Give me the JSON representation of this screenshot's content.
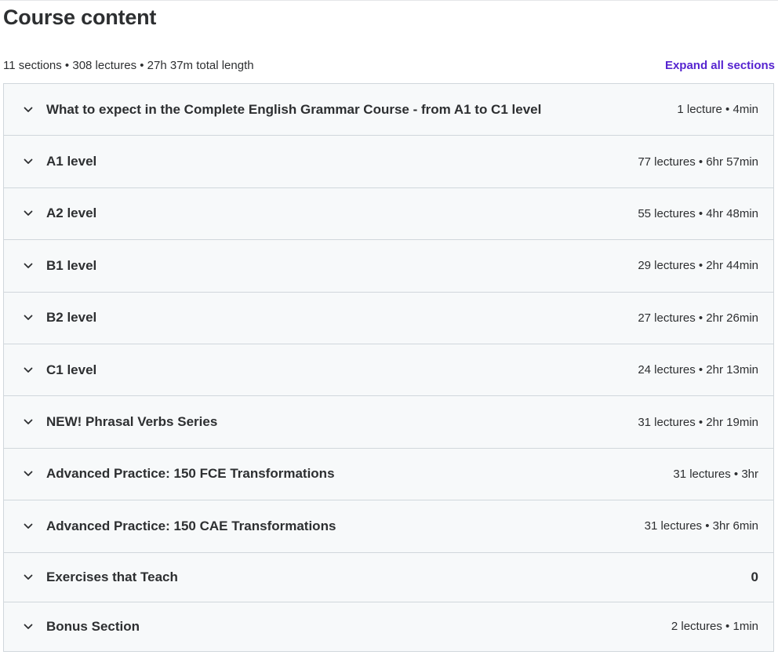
{
  "header": {
    "title": "Course content",
    "summary": "11 sections • 308 lectures • 27h 37m total length",
    "expand_all_label": "Expand all sections"
  },
  "colors": {
    "accent": "#5624d0",
    "section_bg": "#f7f9fa",
    "border": "#d1d7dc",
    "text": "#2d2f31"
  },
  "icons": {
    "section_toggle": "chevron-down-icon"
  },
  "sections": [
    {
      "title": "What to expect in the Complete English Grammar Course - from A1 to C1 level",
      "meta": "1 lecture • 4min"
    },
    {
      "title": "A1 level",
      "meta": "77 lectures • 6hr 57min"
    },
    {
      "title": "A2 level",
      "meta": "55 lectures • 4hr 48min"
    },
    {
      "title": "B1 level",
      "meta": "29 lectures • 2hr 44min"
    },
    {
      "title": "B2 level",
      "meta": "27 lectures • 2hr 26min"
    },
    {
      "title": "C1 level",
      "meta": "24 lectures • 2hr 13min"
    },
    {
      "title": "NEW! Phrasal Verbs Series",
      "meta": "31 lectures • 2hr 19min"
    },
    {
      "title": "Advanced Practice: 150 FCE Transformations",
      "meta": "31 lectures • 3hr"
    },
    {
      "title": "Advanced Practice: 150 CAE Transformations",
      "meta": "31 lectures • 3hr 6min"
    },
    {
      "title": "Exercises that Teach",
      "meta": "0"
    },
    {
      "title": "Bonus Section",
      "meta": "2 lectures • 1min"
    }
  ]
}
